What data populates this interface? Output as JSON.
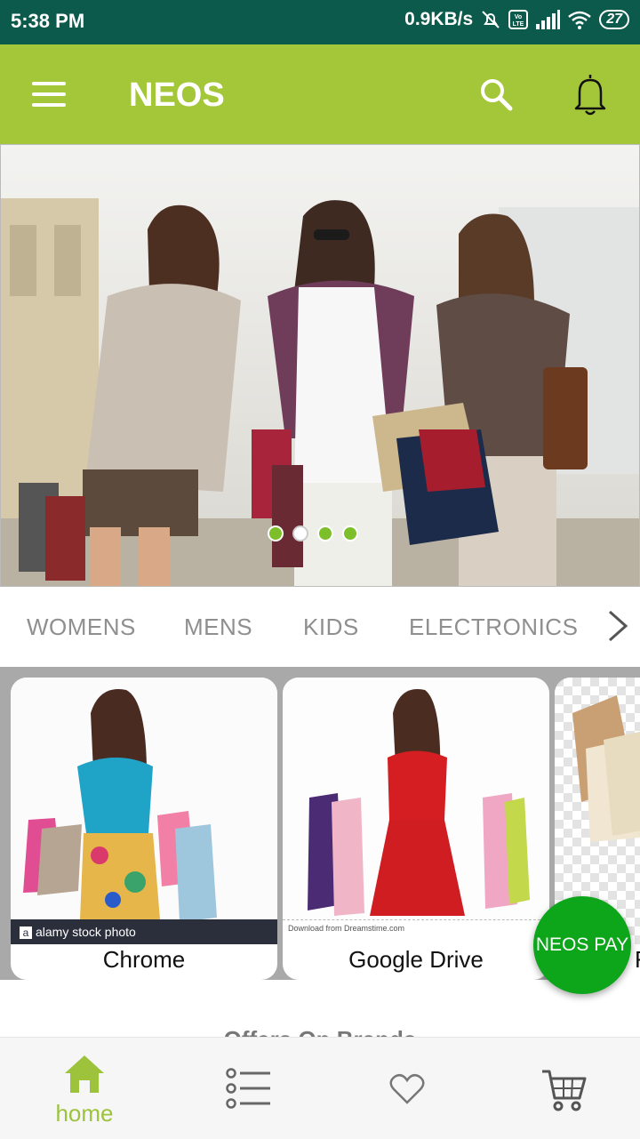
{
  "status_bar": {
    "time": "5:38 PM",
    "network_speed": "0.9KB/s",
    "battery": "27"
  },
  "app_bar": {
    "title": "NEOS",
    "icons": [
      "menu-icon",
      "search-icon",
      "bell-icon"
    ]
  },
  "banner": {
    "slide_count": 4,
    "active_slide": 2
  },
  "categories": [
    "WOMENS",
    "MENS",
    "KIDS",
    "ELECTRONICS"
  ],
  "products": [
    {
      "label": "Chrome",
      "watermark": "alamy stock photo"
    },
    {
      "label": "Google Drive",
      "watermark": "Download from Dreamstime.com"
    },
    {
      "label": "F"
    }
  ],
  "fab": {
    "label": "NEOS PAY"
  },
  "offers": {
    "title": "Offers On Brands"
  },
  "bottom_nav": {
    "items": [
      {
        "label": "home",
        "icon": "home-icon",
        "active": true
      },
      {
        "label": "",
        "icon": "list-icon"
      },
      {
        "label": "",
        "icon": "heart-icon"
      },
      {
        "label": "",
        "icon": "cart-icon"
      }
    ]
  },
  "colors": {
    "status_bar": "#0b5a4c",
    "app_bar": "#a4c739",
    "accent_green": "#9cc33b",
    "fab": "#0da51a"
  }
}
